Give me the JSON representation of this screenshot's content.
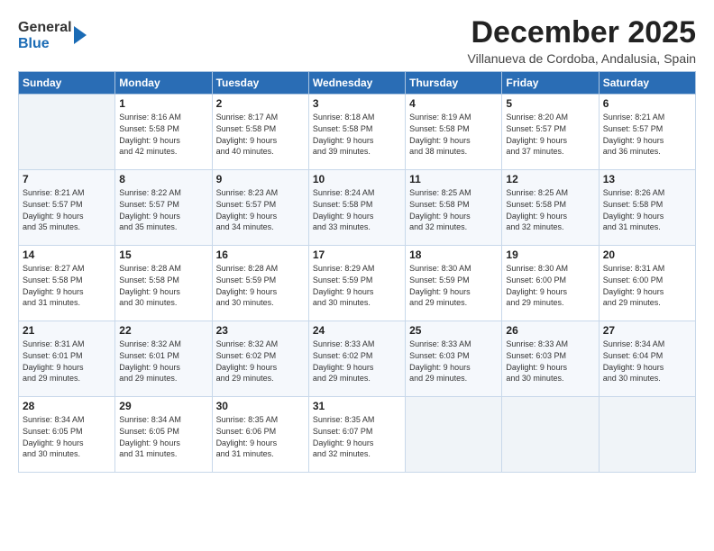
{
  "logo": {
    "general": "General",
    "blue": "Blue"
  },
  "title": "December 2025",
  "subtitle": "Villanueva de Cordoba, Andalusia, Spain",
  "header_days": [
    "Sunday",
    "Monday",
    "Tuesday",
    "Wednesday",
    "Thursday",
    "Friday",
    "Saturday"
  ],
  "weeks": [
    [
      {
        "day": "",
        "info": ""
      },
      {
        "day": "1",
        "info": "Sunrise: 8:16 AM\nSunset: 5:58 PM\nDaylight: 9 hours\nand 42 minutes."
      },
      {
        "day": "2",
        "info": "Sunrise: 8:17 AM\nSunset: 5:58 PM\nDaylight: 9 hours\nand 40 minutes."
      },
      {
        "day": "3",
        "info": "Sunrise: 8:18 AM\nSunset: 5:58 PM\nDaylight: 9 hours\nand 39 minutes."
      },
      {
        "day": "4",
        "info": "Sunrise: 8:19 AM\nSunset: 5:58 PM\nDaylight: 9 hours\nand 38 minutes."
      },
      {
        "day": "5",
        "info": "Sunrise: 8:20 AM\nSunset: 5:57 PM\nDaylight: 9 hours\nand 37 minutes."
      },
      {
        "day": "6",
        "info": "Sunrise: 8:21 AM\nSunset: 5:57 PM\nDaylight: 9 hours\nand 36 minutes."
      }
    ],
    [
      {
        "day": "7",
        "info": "Sunrise: 8:21 AM\nSunset: 5:57 PM\nDaylight: 9 hours\nand 35 minutes."
      },
      {
        "day": "8",
        "info": "Sunrise: 8:22 AM\nSunset: 5:57 PM\nDaylight: 9 hours\nand 35 minutes."
      },
      {
        "day": "9",
        "info": "Sunrise: 8:23 AM\nSunset: 5:57 PM\nDaylight: 9 hours\nand 34 minutes."
      },
      {
        "day": "10",
        "info": "Sunrise: 8:24 AM\nSunset: 5:58 PM\nDaylight: 9 hours\nand 33 minutes."
      },
      {
        "day": "11",
        "info": "Sunrise: 8:25 AM\nSunset: 5:58 PM\nDaylight: 9 hours\nand 32 minutes."
      },
      {
        "day": "12",
        "info": "Sunrise: 8:25 AM\nSunset: 5:58 PM\nDaylight: 9 hours\nand 32 minutes."
      },
      {
        "day": "13",
        "info": "Sunrise: 8:26 AM\nSunset: 5:58 PM\nDaylight: 9 hours\nand 31 minutes."
      }
    ],
    [
      {
        "day": "14",
        "info": "Sunrise: 8:27 AM\nSunset: 5:58 PM\nDaylight: 9 hours\nand 31 minutes."
      },
      {
        "day": "15",
        "info": "Sunrise: 8:28 AM\nSunset: 5:58 PM\nDaylight: 9 hours\nand 30 minutes."
      },
      {
        "day": "16",
        "info": "Sunrise: 8:28 AM\nSunset: 5:59 PM\nDaylight: 9 hours\nand 30 minutes."
      },
      {
        "day": "17",
        "info": "Sunrise: 8:29 AM\nSunset: 5:59 PM\nDaylight: 9 hours\nand 30 minutes."
      },
      {
        "day": "18",
        "info": "Sunrise: 8:30 AM\nSunset: 5:59 PM\nDaylight: 9 hours\nand 29 minutes."
      },
      {
        "day": "19",
        "info": "Sunrise: 8:30 AM\nSunset: 6:00 PM\nDaylight: 9 hours\nand 29 minutes."
      },
      {
        "day": "20",
        "info": "Sunrise: 8:31 AM\nSunset: 6:00 PM\nDaylight: 9 hours\nand 29 minutes."
      }
    ],
    [
      {
        "day": "21",
        "info": "Sunrise: 8:31 AM\nSunset: 6:01 PM\nDaylight: 9 hours\nand 29 minutes."
      },
      {
        "day": "22",
        "info": "Sunrise: 8:32 AM\nSunset: 6:01 PM\nDaylight: 9 hours\nand 29 minutes."
      },
      {
        "day": "23",
        "info": "Sunrise: 8:32 AM\nSunset: 6:02 PM\nDaylight: 9 hours\nand 29 minutes."
      },
      {
        "day": "24",
        "info": "Sunrise: 8:33 AM\nSunset: 6:02 PM\nDaylight: 9 hours\nand 29 minutes."
      },
      {
        "day": "25",
        "info": "Sunrise: 8:33 AM\nSunset: 6:03 PM\nDaylight: 9 hours\nand 29 minutes."
      },
      {
        "day": "26",
        "info": "Sunrise: 8:33 AM\nSunset: 6:03 PM\nDaylight: 9 hours\nand 30 minutes."
      },
      {
        "day": "27",
        "info": "Sunrise: 8:34 AM\nSunset: 6:04 PM\nDaylight: 9 hours\nand 30 minutes."
      }
    ],
    [
      {
        "day": "28",
        "info": "Sunrise: 8:34 AM\nSunset: 6:05 PM\nDaylight: 9 hours\nand 30 minutes."
      },
      {
        "day": "29",
        "info": "Sunrise: 8:34 AM\nSunset: 6:05 PM\nDaylight: 9 hours\nand 31 minutes."
      },
      {
        "day": "30",
        "info": "Sunrise: 8:35 AM\nSunset: 6:06 PM\nDaylight: 9 hours\nand 31 minutes."
      },
      {
        "day": "31",
        "info": "Sunrise: 8:35 AM\nSunset: 6:07 PM\nDaylight: 9 hours\nand 32 minutes."
      },
      {
        "day": "",
        "info": ""
      },
      {
        "day": "",
        "info": ""
      },
      {
        "day": "",
        "info": ""
      }
    ]
  ]
}
